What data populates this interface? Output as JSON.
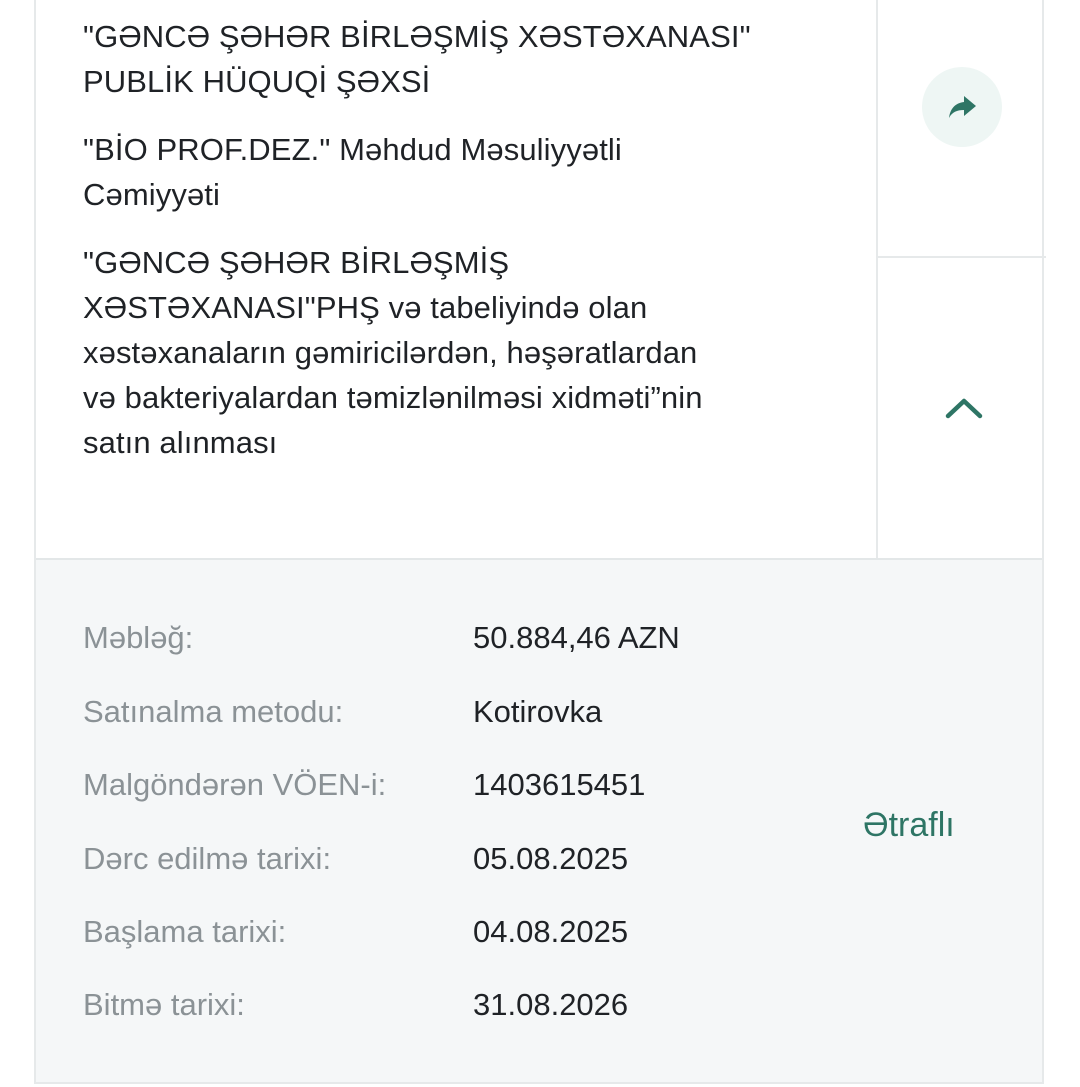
{
  "tender": {
    "organization_lines": [
      "\"GƏNCƏ ŞƏHƏR BİRLƏŞMİŞ XƏSTƏXANASI\"",
      "PUBLİK HÜQUQİ ŞƏXSİ"
    ],
    "supplier_lines": [
      "\"BİO PROF.DEZ.\" Məhdud Məsuliyyətli",
      "Cəmiyyəti"
    ],
    "subject_lines": [
      "\"GƏNCƏ ŞƏHƏR BİRLƏŞMİŞ",
      "XƏSTƏXANASI\"PHŞ və tabeliyində olan",
      "xəstəxanaların gəmiricilərdən, həşəratlardan",
      "və bakteriyalardan təmizlənilməsi xidməti”nin",
      "satın alınması"
    ]
  },
  "actions": {
    "share_icon": "share-arrow-icon",
    "collapse_icon": "chevron-up-icon",
    "more_label": "Ətraflı"
  },
  "details": [
    {
      "label": "Məbləğ:",
      "value": "50.884,46 AZN"
    },
    {
      "label": "Satınalma metodu:",
      "value": "Kotirovka"
    },
    {
      "label": "Malgöndərən VÖEN-i:",
      "value": "1403615451"
    },
    {
      "label": "Dərc edilmə tarixi:",
      "value": "05.08.2025"
    },
    {
      "label": "Başlama tarixi:",
      "value": "04.08.2025"
    },
    {
      "label": "Bitmə tarixi:",
      "value": "31.08.2026"
    }
  ],
  "colors": {
    "accent": "#2e7565",
    "label_gray": "#8b9296",
    "details_bg": "#f5f7f8",
    "share_bg": "#eef6f4"
  }
}
